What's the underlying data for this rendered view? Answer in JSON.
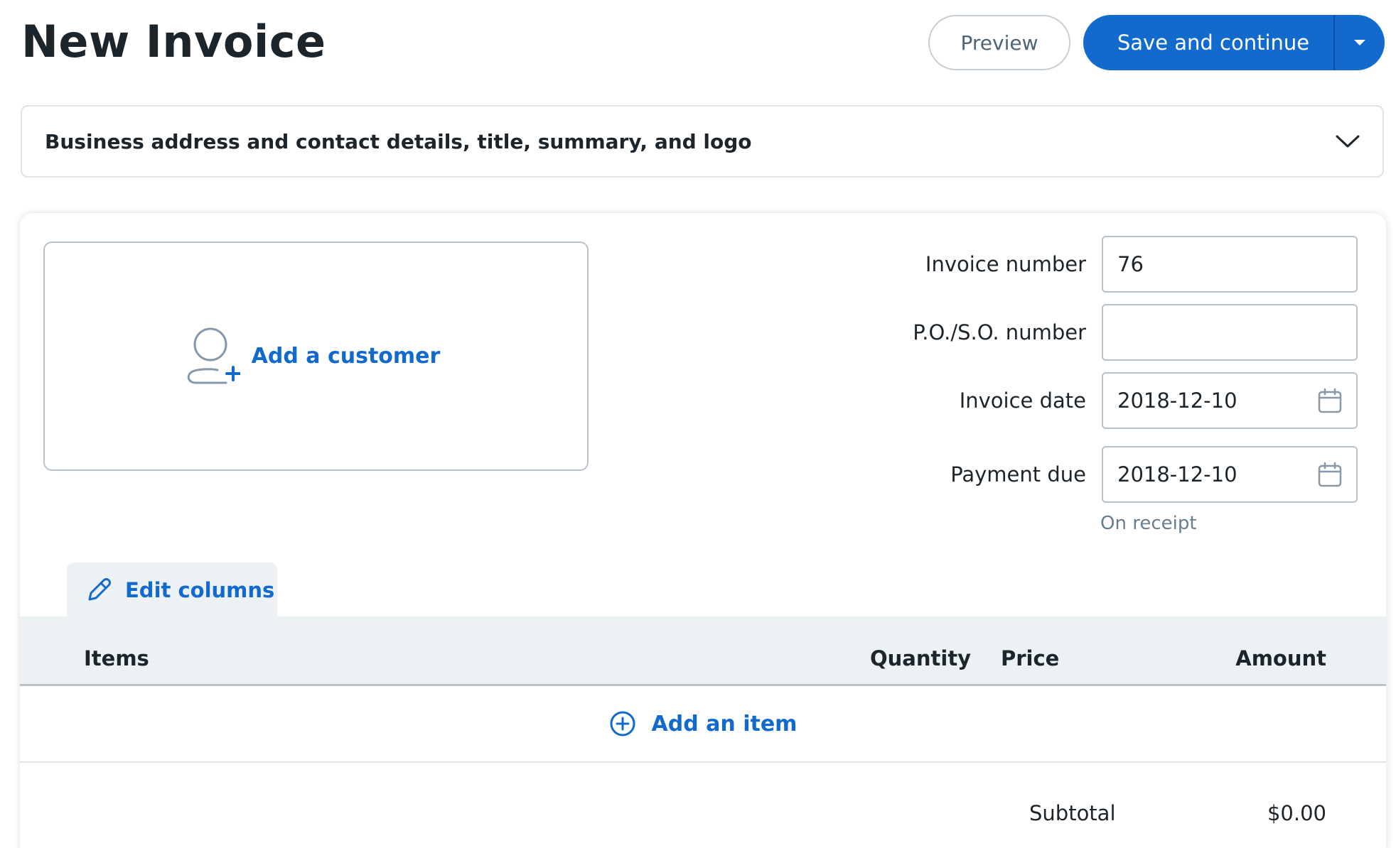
{
  "header": {
    "title": "New Invoice",
    "preview_label": "Preview",
    "save_label": "Save and continue"
  },
  "business_section": {
    "title": "Business address and contact details, title, summary, and logo"
  },
  "customer": {
    "add_label": "Add a customer"
  },
  "fields": {
    "invoice_number": {
      "label": "Invoice number",
      "value": "76"
    },
    "po_so_number": {
      "label": "P.O./S.O. number",
      "value": ""
    },
    "invoice_date": {
      "label": "Invoice date",
      "value": "2018-12-10"
    },
    "payment_due": {
      "label": "Payment due",
      "value": "2018-12-10",
      "hint": "On receipt"
    }
  },
  "items_table": {
    "edit_columns_label": "Edit columns",
    "columns": [
      "Items",
      "Quantity",
      "Price",
      "Amount"
    ],
    "add_item_label": "Add an item"
  },
  "totals": {
    "subtotal_label": "Subtotal",
    "subtotal_value": "$0.00"
  },
  "colors": {
    "primary": "#136acd",
    "text": "#1c252c",
    "muted": "#687e8e",
    "border": "#b8c2cc",
    "table_header_bg": "#ecf1f4"
  }
}
